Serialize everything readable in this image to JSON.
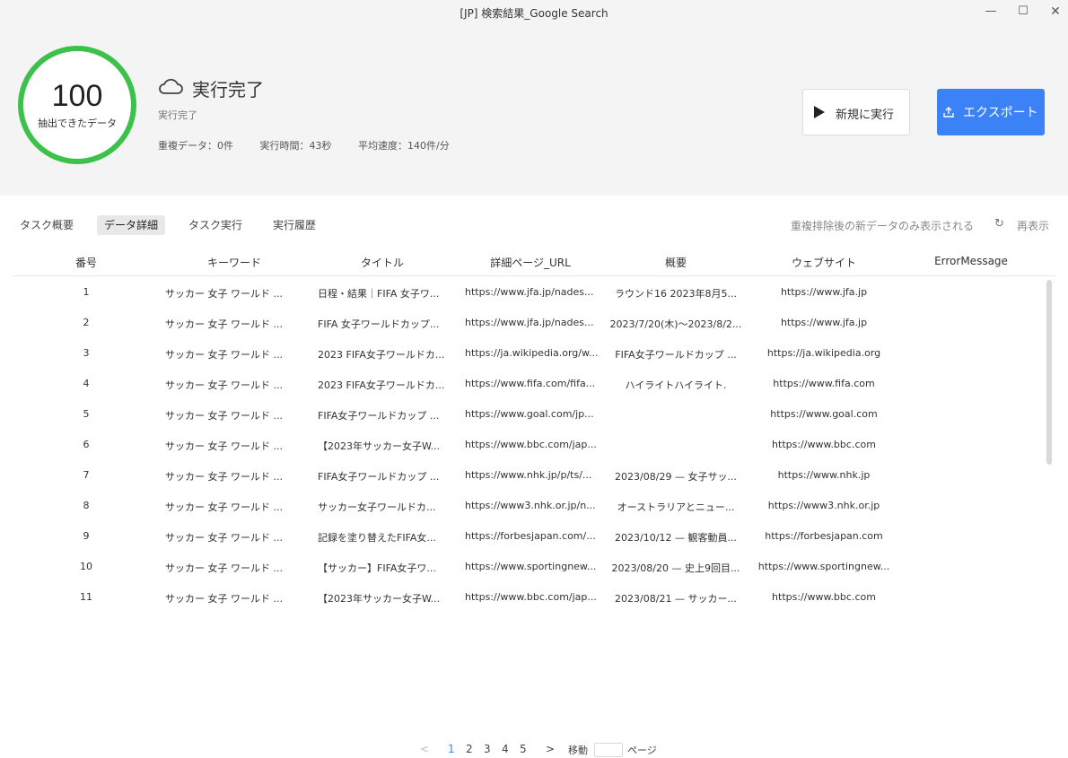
{
  "window": {
    "title": "[JP] 検索結果_Google Search",
    "minimize": "—",
    "maximize": "☐",
    "close": "✕"
  },
  "summary": {
    "count": "100",
    "count_label": "抽出できたデータ",
    "status_title": "実行完了",
    "status_sub": "実行完了",
    "duplicates": "重複データ：0件",
    "exec_time": "実行時間：43秒",
    "avg_speed": "平均速度：140件/分",
    "progress_color": "#3cc14a"
  },
  "actions": {
    "run_label": "新規に実行",
    "export_label": "エクスポート",
    "export_color": "#3b82f6"
  },
  "tabs": [
    {
      "label": "タスク概要",
      "active": false
    },
    {
      "label": "データ詳細",
      "active": true
    },
    {
      "label": "タスク実行",
      "active": false
    },
    {
      "label": "実行履歴",
      "active": false
    }
  ],
  "toolbar": {
    "dedupe_note": "重複排除後の新データのみ表示される",
    "refresh_label": "再表示",
    "refresh_icon": "↻"
  },
  "table": {
    "columns": [
      "番号",
      "キーワード",
      "タイトル",
      "詳細ページ_URL",
      "概要",
      "ウェブサイト",
      "ErrorMessage"
    ],
    "rows": [
      [
        "1",
        "サッカー 女子 ワールド ...",
        "日程・結果｜FIFA 女子ワ...",
        "https://www.jfa.jp/nades...",
        "ラウンド16 2023年8月5...",
        "https://www.jfa.jp",
        ""
      ],
      [
        "2",
        "サッカー 女子 ワールド ...",
        "FIFA 女子ワールドカップ...",
        "https://www.jfa.jp/nades...",
        "2023/7/20(木)〜2023/8/2...",
        "https://www.jfa.jp",
        ""
      ],
      [
        "3",
        "サッカー 女子 ワールド ...",
        "2023 FIFA女子ワールドカ...",
        "https://ja.wikipedia.org/w...",
        "FIFA女子ワールドカップ ...",
        "https://ja.wikipedia.org",
        ""
      ],
      [
        "4",
        "サッカー 女子 ワールド ...",
        "2023 FIFA女子ワールドカ...",
        "https://www.fifa.com/fifa...",
        "ハイライトハイライト.",
        "https://www.fifa.com",
        ""
      ],
      [
        "5",
        "サッカー 女子 ワールド ...",
        "FIFA女子ワールドカップ ...",
        "https://www.goal.com/jp...",
        "",
        "https://www.goal.com",
        ""
      ],
      [
        "6",
        "サッカー 女子 ワールド ...",
        "【2023年サッカー女子W...",
        "https://www.bbc.com/jap...",
        "",
        "https://www.bbc.com",
        ""
      ],
      [
        "7",
        "サッカー 女子 ワールド ...",
        "FIFA女子ワールドカップ ...",
        "https://www.nhk.jp/p/ts/...",
        "2023/08/29 — 女子サッ...",
        "https://www.nhk.jp",
        ""
      ],
      [
        "8",
        "サッカー 女子 ワールド ...",
        "サッカー女子ワールドカ...",
        "https://www3.nhk.or.jp/n...",
        "オーストラリアとニュー...",
        "https://www3.nhk.or.jp",
        ""
      ],
      [
        "9",
        "サッカー 女子 ワールド ...",
        "記録を塗り替えたFIFA女...",
        "https://forbesjapan.com/...",
        "2023/10/12 — 観客動員...",
        "https://forbesjapan.com",
        ""
      ],
      [
        "10",
        "サッカー 女子 ワールド ...",
        "【サッカー】FIFA女子ワ...",
        "https://www.sportingnew...",
        "2023/08/20 — 史上9回目...",
        "https://www.sportingnew...",
        ""
      ],
      [
        "11",
        "サッカー 女子 ワールド ...",
        "【2023年サッカー女子W...",
        "https://www.bbc.com/jap...",
        "2023/08/21 — サッカー...",
        "https://www.bbc.com",
        ""
      ]
    ]
  },
  "pagination": {
    "prev": "<",
    "next": ">",
    "pages": [
      "1",
      "2",
      "3",
      "4",
      "5"
    ],
    "current": "1",
    "jump_label": "移動",
    "page_label": "ページ"
  }
}
